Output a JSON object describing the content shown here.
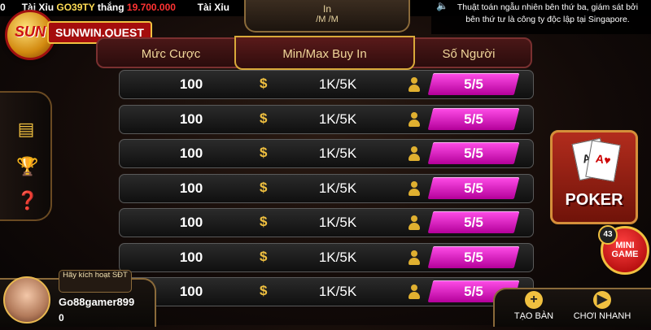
{
  "ticker": {
    "segment1_end": "0",
    "game_name": "Tài Xỉu",
    "player_code": "GO39TY",
    "won_label": "thắng",
    "amount": "19.700.000",
    "game_name2": "Tài Xỉu"
  },
  "top_tab": {
    "line1": "In",
    "line2": "/M   /M"
  },
  "notice": {
    "speaker_icon": "speaker-icon",
    "text": "Thuật toán ngẫu nhiên bên thứ ba, giám sát bởi bên thứ tư là công ty độc lập tại Singapore."
  },
  "logo": {
    "badge": "SUN",
    "name": "SUNWIN.QUEST"
  },
  "headers": {
    "bet": "Mức Cược",
    "buyin": "Min/Max Buy In",
    "players": "Số Người"
  },
  "rows": [
    {
      "bet": "100",
      "buyin": "1K/5K",
      "players": "5/5"
    },
    {
      "bet": "100",
      "buyin": "1K/5K",
      "players": "5/5"
    },
    {
      "bet": "100",
      "buyin": "1K/5K",
      "players": "5/5"
    },
    {
      "bet": "100",
      "buyin": "1K/5K",
      "players": "5/5"
    },
    {
      "bet": "100",
      "buyin": "1K/5K",
      "players": "5/5"
    },
    {
      "bet": "100",
      "buyin": "1K/5K",
      "players": "5/5"
    },
    {
      "bet": "100",
      "buyin": "1K/5K",
      "players": "5/5"
    }
  ],
  "icons": {
    "dollar": "$"
  },
  "poker": {
    "label": "POKER",
    "card1": "A♠",
    "card2": "A♥"
  },
  "mini_game": {
    "badge": "43",
    "label_line1": "MINI",
    "label_line2": "GAME"
  },
  "user": {
    "activate_label": "Hãy kích hoạt SĐT",
    "username": "Go88gamer899",
    "balance": "0"
  },
  "actions": {
    "create_table": "TẠO BÀN",
    "quick_play": "CHƠI NHANH"
  },
  "colors": {
    "accent_gold": "#f0c040",
    "players_pink": "#ff4de8",
    "header_red": "#5a1a1a"
  }
}
